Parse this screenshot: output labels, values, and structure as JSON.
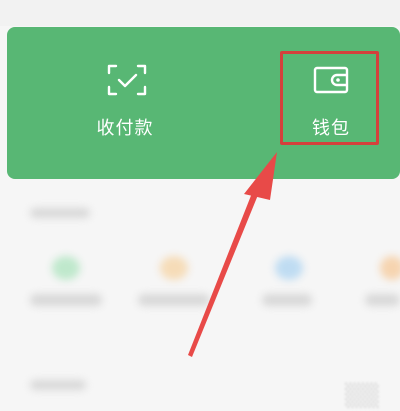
{
  "actions": {
    "pay_label": "收付款",
    "wallet_label": "钱包"
  },
  "colors": {
    "panel_green": "#58b774",
    "highlight_red": "#d4403c",
    "arrow_red": "#e84a48"
  },
  "icons": {
    "pay": "scan-check-icon",
    "wallet": "wallet-icon"
  }
}
